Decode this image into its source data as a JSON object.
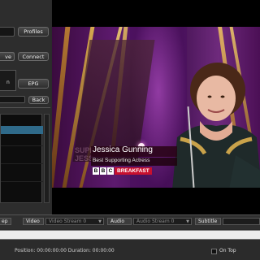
{
  "controls": {
    "top_field_value": "",
    "profiles_label": "Profiles",
    "save_label": "ve",
    "connect_label": "Connect",
    "epg_label": "EPG",
    "back_label": "Back"
  },
  "video_overlay": {
    "name": "Jessica Gunning",
    "role": "Best Supporting Actress",
    "bbc_letters": [
      "B",
      "B",
      "C"
    ],
    "channel": "BREAKFAST",
    "bg_text": "SUPPO JESS",
    "colors": {
      "name_banner": "#5b0a1e",
      "bbc_red": "#c8102e"
    }
  },
  "bottom_bar": {
    "left_label": "ep",
    "video_label": "Video",
    "video_stream": "Video Stream 0",
    "audio_label": "Audio",
    "audio_stream": "Audio Stream 0",
    "subtitle_label": "Subtitle"
  },
  "status": {
    "position_text": "Position: 00:00:00:00 Duration: 00:00:00",
    "ontop_label": "On Top"
  }
}
